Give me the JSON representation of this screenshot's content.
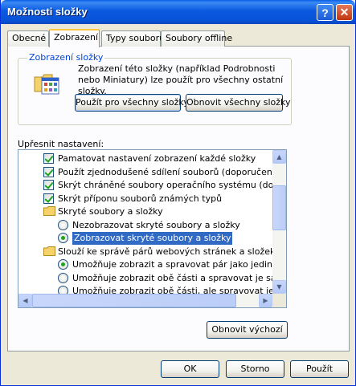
{
  "window": {
    "title": "Možnosti složky",
    "help_glyph": "?",
    "close_glyph": "✕"
  },
  "tabs": [
    {
      "label": "Obecné"
    },
    {
      "label": "Zobrazení",
      "active": true
    },
    {
      "label": "Typy souborů"
    },
    {
      "label": "Soubory offline"
    }
  ],
  "folder_views": {
    "legend": "Zobrazení složky",
    "description": "Zobrazení této složky (například Podrobnosti nebo Miniatury) lze použít pro všechny ostatní složky.",
    "apply_all_label": "Použít pro všechny složky",
    "reset_all_label": "Obnovit všechny složky"
  },
  "advanced": {
    "label": "Upřesnit nastavení:",
    "items": [
      {
        "type": "checkbox",
        "checked": true,
        "indent": 1,
        "label": "Pamatovat nastavení zobrazení každé složky"
      },
      {
        "type": "checkbox",
        "checked": true,
        "indent": 1,
        "label": "Použít zjednodušené sdílení souborů (doporučeno)"
      },
      {
        "type": "checkbox",
        "checked": true,
        "indent": 1,
        "label": "Skrýt chráněné soubory operačního systému (doporučen"
      },
      {
        "type": "checkbox",
        "checked": true,
        "indent": 1,
        "label": "Skrýt příponu souborů známých typů"
      },
      {
        "type": "folder",
        "indent": 1,
        "label": "Skryté soubory a složky"
      },
      {
        "type": "radio",
        "checked": false,
        "indent": 2,
        "label": "Nezobrazovat skryté soubory a složky"
      },
      {
        "type": "radio",
        "checked": true,
        "selected": true,
        "indent": 2,
        "label": "Zobrazovat skryté soubory a složky"
      },
      {
        "type": "folder",
        "indent": 1,
        "label": "Slouží ke správě párů webových stránek a složek."
      },
      {
        "type": "radio",
        "checked": true,
        "indent": 2,
        "label": "Umožňuje zobrazit a spravovat pár jako jediný soubo"
      },
      {
        "type": "radio",
        "checked": false,
        "indent": 2,
        "label": "Umožňuje zobrazit obě části a spravovat je samostat"
      },
      {
        "type": "radio",
        "checked": false,
        "indent": 2,
        "label": "Umožňuje zobrazit obě části, ale spravovat je jako je"
      }
    ],
    "restore_defaults_label": "Obnovit výchozí"
  },
  "footer": {
    "ok_label": "OK",
    "cancel_label": "Storno",
    "apply_label": "Použít"
  }
}
